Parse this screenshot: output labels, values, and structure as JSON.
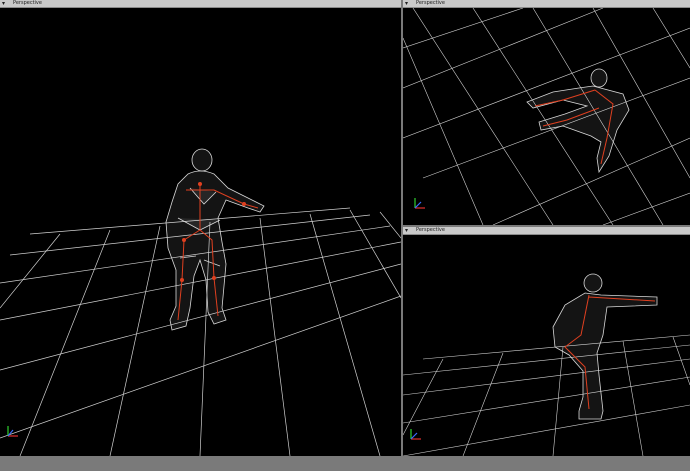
{
  "viewports": {
    "main": {
      "label": "Perspective",
      "menu_icon": "viewport-menu-icon"
    },
    "top_right": {
      "label": "Perspective",
      "menu_icon": "viewport-menu-icon"
    },
    "bottom_right": {
      "label": "Perspective",
      "menu_icon": "viewport-menu-icon"
    }
  },
  "axis_gizmo": {
    "x_color": "#e03030",
    "y_color": "#30d030",
    "z_color": "#3a6cff"
  },
  "colors": {
    "background": "#000000",
    "grid": "#e8e8e8",
    "mesh": "#d8d8d8",
    "bones": "#e04020",
    "frame": "#7a7a7a"
  }
}
